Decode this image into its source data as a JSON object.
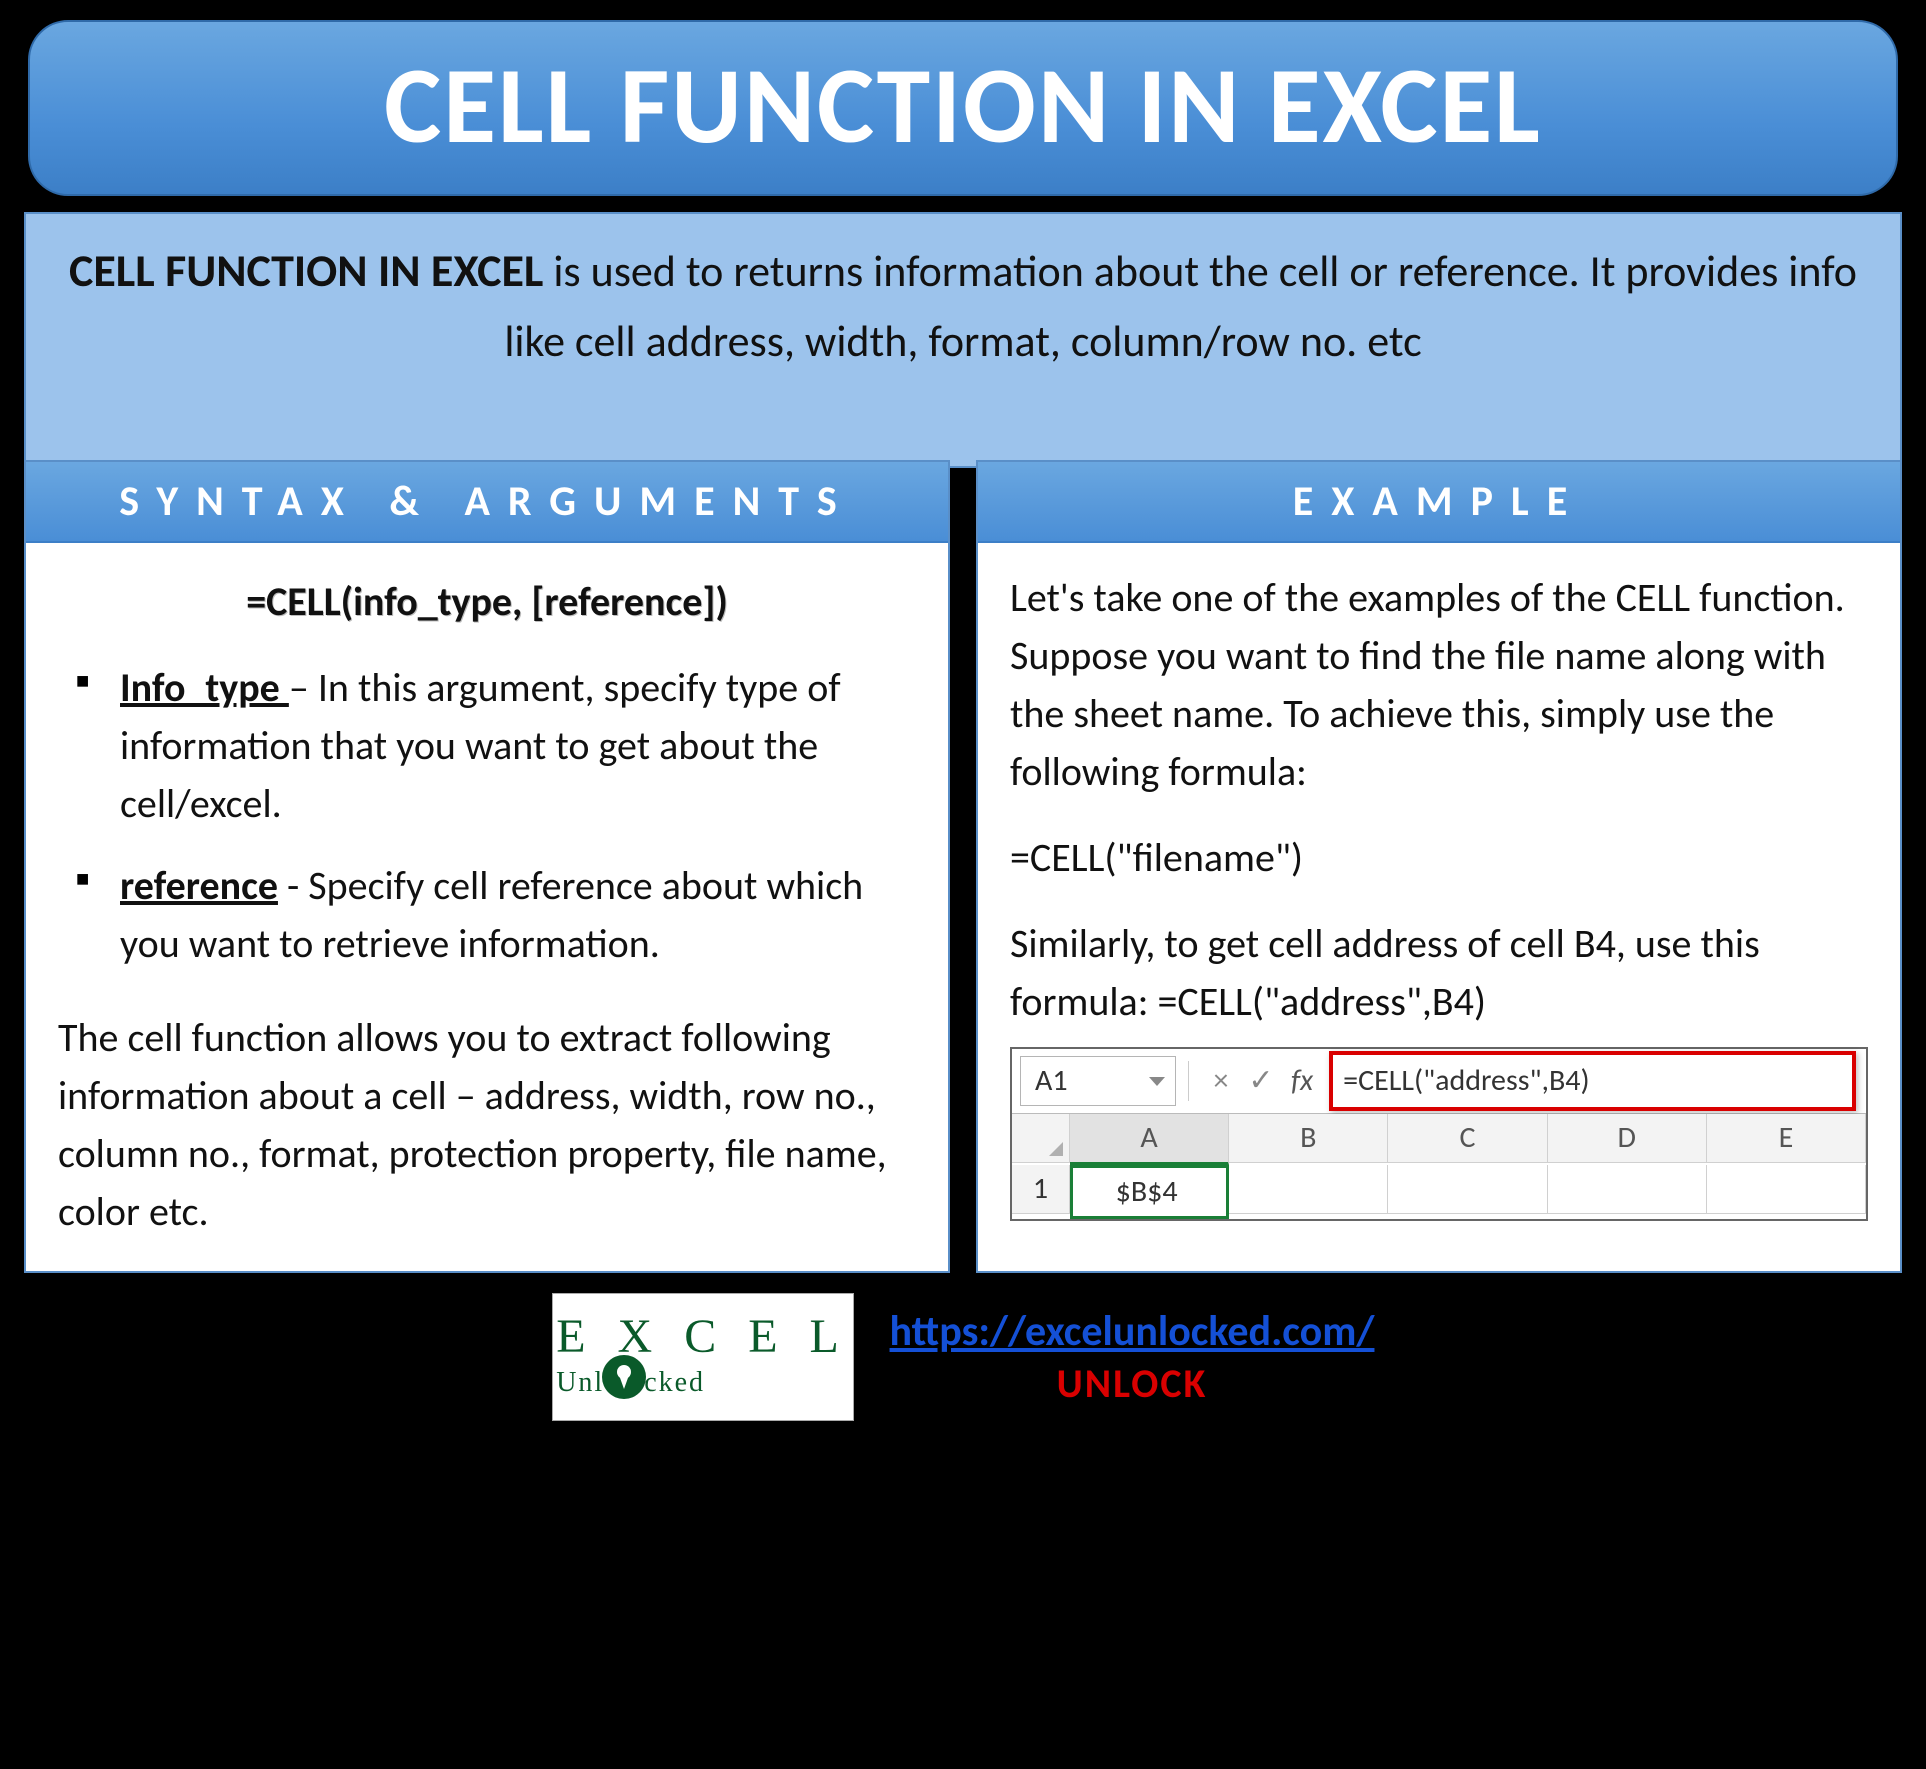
{
  "title": "CELL FUNCTION IN EXCEL",
  "intro": {
    "bold": "CELL FUNCTION IN EXCEL",
    "rest": " is used to returns information about the cell or reference. It provides info like cell address, width, format, column/row no. etc"
  },
  "left": {
    "header": "SYNTAX & ARGUMENTS",
    "syntax": "=CELL(info_type, [reference])",
    "args": [
      {
        "name": "Info_type ",
        "desc": "– In this argument, specify type of information that you want to get about the cell/excel."
      },
      {
        "name": "reference",
        "desc": " - Specify cell reference about which you want to retrieve information."
      }
    ],
    "para": "The cell function allows you to extract following information about a cell – address, width, row no., column no., format, protection property, file name, color etc."
  },
  "right": {
    "header": "EXAMPLE",
    "intro": "Let's take one of the examples of the CELL function. Suppose you want to find the file name along with the sheet name. To achieve this, simply use the following formula:",
    "formula1": "=CELL(\"filename\")",
    "para2": "Similarly, to get cell address of cell B4, use this formula: =CELL(\"address\",B4)",
    "shot": {
      "namebox": "A1",
      "fx_label": "fx",
      "formula": "=CELL(\"address\",B4)",
      "cols": [
        "A",
        "B",
        "C",
        "D",
        "E"
      ],
      "row1_label": "1",
      "a1_value": "$B$4"
    }
  },
  "footer": {
    "logo_top": "E X C E L",
    "logo_sub": "Unl   cked",
    "url": "https://excelunlocked.com/",
    "unlock": "UNLOCK"
  }
}
